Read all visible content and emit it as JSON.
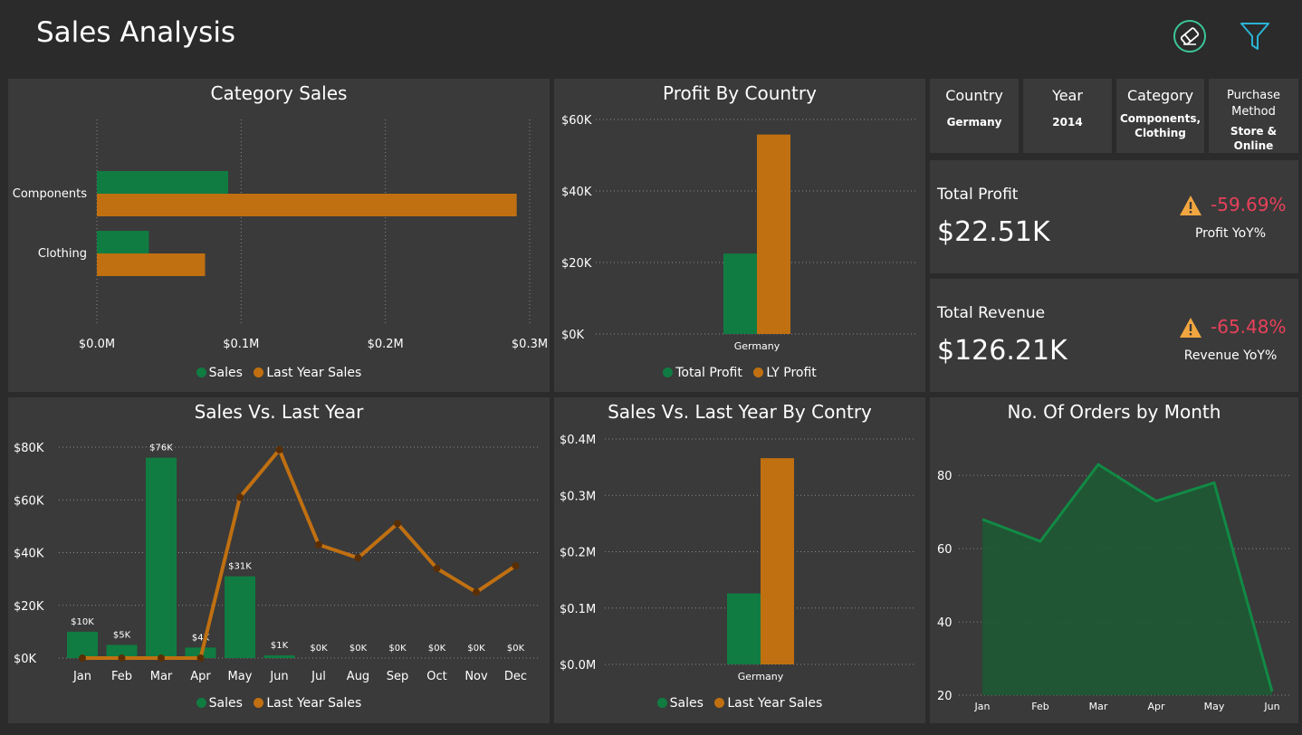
{
  "header": {
    "title": "Sales Analysis",
    "icons": [
      "eraser-icon",
      "filter-icon"
    ]
  },
  "colors": {
    "sales": "#107c41",
    "last_year": "#c07011",
    "negative": "#e8405a",
    "warning": "#f2a640",
    "panel": "#3a3a3a"
  },
  "filters": [
    {
      "label": "Country",
      "value": "Germany"
    },
    {
      "label": "Year",
      "value": "2014"
    },
    {
      "label": "Category",
      "value": "Components, Clothing"
    },
    {
      "label": "Purchase Method",
      "value": "Store & Online"
    }
  ],
  "kpis": {
    "profit": {
      "label": "Total Profit",
      "value": "$22.51K",
      "change": "-59.69%",
      "change_label": "Profit YoY%"
    },
    "revenue": {
      "label": "Total Revenue",
      "value": "$126.21K",
      "change": "-65.48%",
      "change_label": "Revenue YoY%"
    }
  },
  "panels": {
    "category_sales": {
      "title": "Category Sales",
      "legend": [
        "Sales",
        "Last Year  Sales"
      ]
    },
    "profit_country": {
      "title": "Profit By Country",
      "legend": [
        "Total Profit",
        "LY Profit"
      ]
    },
    "sales_vs_ly": {
      "title": "Sales Vs. Last Year",
      "legend": [
        "Sales",
        "Last Year Sales"
      ]
    },
    "sales_vs_ly_country": {
      "title": "Sales Vs. Last Year By Contry",
      "legend": [
        "Sales",
        "Last Year Sales"
      ]
    },
    "orders_month": {
      "title": "No. Of Orders by Month"
    }
  },
  "chart_data": [
    {
      "id": "category_sales",
      "type": "bar",
      "orientation": "horizontal",
      "title": "Category Sales",
      "categories": [
        "Components",
        "Clothing"
      ],
      "series": [
        {
          "name": "Sales",
          "values": [
            0.091,
            0.036
          ]
        },
        {
          "name": "Last Year  Sales",
          "values": [
            0.291,
            0.075
          ]
        }
      ],
      "xlim": [
        0,
        0.3
      ],
      "ticks": [
        0,
        0.1,
        0.2,
        0.3
      ],
      "tick_labels": [
        "$0.0M",
        "$0.1M",
        "$0.2M",
        "$0.3M"
      ],
      "unit": "$M",
      "grid": true,
      "legend_position": "bottom"
    },
    {
      "id": "profit_country",
      "type": "bar",
      "title": "Profit By Country",
      "categories": [
        "Germany"
      ],
      "series": [
        {
          "name": "Total Profit",
          "values": [
            22.51
          ]
        },
        {
          "name": "LY Profit",
          "values": [
            55.8
          ]
        }
      ],
      "ylim": [
        0,
        60
      ],
      "ticks": [
        0,
        20,
        40,
        60
      ],
      "tick_labels": [
        "$0K",
        "$20K",
        "$40K",
        "$60K"
      ],
      "unit": "$K",
      "grid": true,
      "legend_position": "bottom"
    },
    {
      "id": "sales_vs_ly",
      "type": "bar",
      "title": "Sales Vs. Last Year",
      "categories": [
        "Jan",
        "Feb",
        "Mar",
        "Apr",
        "May",
        "Jun",
        "Jul",
        "Aug",
        "Sep",
        "Oct",
        "Nov",
        "Dec"
      ],
      "series": [
        {
          "name": "Sales",
          "type": "bar",
          "values": [
            10,
            5,
            76,
            4,
            31,
            1,
            0,
            0,
            0,
            0,
            0,
            0
          ]
        },
        {
          "name": "Last Year Sales",
          "type": "line",
          "values": [
            0,
            0,
            0,
            0,
            61,
            79,
            43,
            38,
            51,
            34,
            25,
            35
          ]
        }
      ],
      "data_labels": [
        "$10K",
        "$5K",
        "$76K",
        "$4K",
        "$31K",
        "$1K",
        "$0K",
        "$0K",
        "$0K",
        "$0K",
        "$0K",
        "$0K"
      ],
      "ylim": [
        0,
        80
      ],
      "ticks": [
        0,
        20,
        40,
        60,
        80
      ],
      "tick_labels": [
        "$0K",
        "$20K",
        "$40K",
        "$60K",
        "$80K"
      ],
      "unit": "$K",
      "grid": true,
      "legend_position": "bottom"
    },
    {
      "id": "sales_vs_ly_country",
      "type": "bar",
      "title": "Sales Vs. Last Year By Contry",
      "categories": [
        "Germany"
      ],
      "series": [
        {
          "name": "Sales",
          "values": [
            0.126
          ]
        },
        {
          "name": "Last Year Sales",
          "values": [
            0.366
          ]
        }
      ],
      "ylim": [
        0,
        0.4
      ],
      "ticks": [
        0,
        0.1,
        0.2,
        0.3,
        0.4
      ],
      "tick_labels": [
        "$0.0M",
        "$0.1M",
        "$0.2M",
        "$0.3M",
        "$0.4M"
      ],
      "unit": "$M",
      "grid": true,
      "legend_position": "bottom"
    },
    {
      "id": "orders_month",
      "type": "area",
      "title": "No. Of Orders by Month",
      "categories": [
        "Jan",
        "Feb",
        "Mar",
        "Apr",
        "May",
        "Jun"
      ],
      "series": [
        {
          "name": "Orders",
          "values": [
            68,
            62,
            83,
            73,
            78,
            21
          ]
        }
      ],
      "ylim": [
        20,
        86
      ],
      "ticks": [
        20,
        40,
        60,
        80
      ],
      "tick_labels": [
        "20",
        "40",
        "60",
        "80"
      ],
      "grid": true
    }
  ]
}
